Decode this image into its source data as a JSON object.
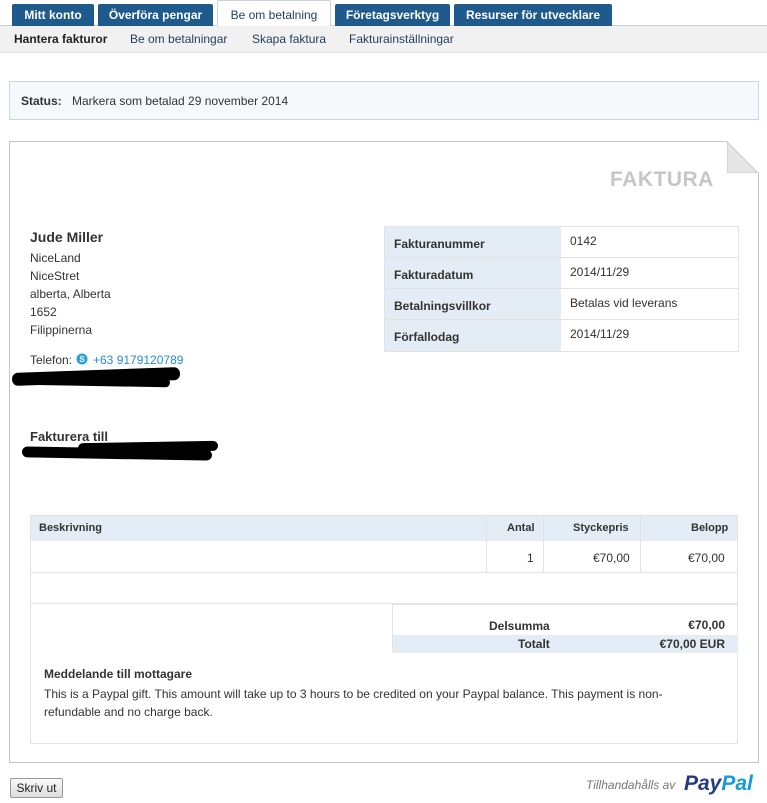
{
  "tabs": [
    {
      "label": "Mitt konto"
    },
    {
      "label": "Överföra pengar"
    },
    {
      "label": "Be om betalning"
    },
    {
      "label": "Företagsverktyg"
    },
    {
      "label": "Resurser för utvecklare"
    }
  ],
  "subnav": [
    {
      "label": "Hantera fakturor"
    },
    {
      "label": "Be om betalningar"
    },
    {
      "label": "Skapa faktura"
    },
    {
      "label": "Fakturainställningar"
    }
  ],
  "status": {
    "label": "Status:",
    "value": "Markera som betalad 29 november 2014"
  },
  "invoice": {
    "title": "FAKTURA",
    "sender": {
      "name": "Jude Miller",
      "address": [
        "NiceLand",
        "NiceStret",
        "alberta, Alberta",
        "1652",
        "Filippinerna"
      ],
      "phone_label": "Telefon:",
      "phone": "+63 9179120789"
    },
    "bill_to": "Fakturera till",
    "meta": [
      {
        "key": "Fakturanummer",
        "value": "0142"
      },
      {
        "key": "Fakturadatum",
        "value": "2014/11/29"
      },
      {
        "key": "Betalningsvillkor",
        "value": "Betalas vid leverans"
      },
      {
        "key": "Förfallodag",
        "value": "2014/11/29"
      }
    ],
    "items_header": {
      "description": "Beskrivning",
      "qty": "Antal",
      "unit_price": "Styckepris",
      "amount": "Belopp"
    },
    "items": [
      {
        "description": "",
        "qty": "1",
        "unit_price": "€70,00",
        "amount": "€70,00"
      }
    ],
    "subtotal_label": "Delsumma",
    "subtotal": "€70,00",
    "total_label": "Totalt",
    "total": "€70,00 EUR",
    "message_title": "Meddelande till mottagare",
    "message": "This is a Paypal gift. This amount will take up to 3 hours to be credited on your Paypal balance. This payment is non-refundable and no charge back."
  },
  "footer": {
    "print_label": "Skriv ut",
    "powered_by": "Tillhandahålls av",
    "logo_part1": "Pay",
    "logo_part2": "Pal"
  },
  "colors": {
    "tab": "#1f5a8c",
    "header_bg": "#e4edf5",
    "link": "#2a8ccf"
  }
}
